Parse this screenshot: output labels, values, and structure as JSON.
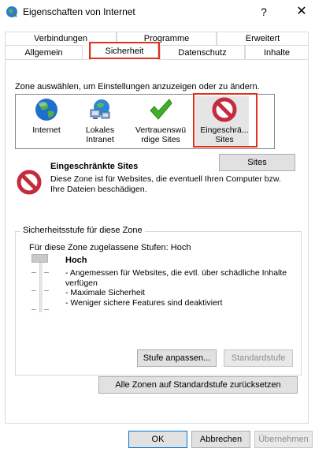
{
  "window": {
    "title": "Eigenschaften von Internet",
    "help_glyph": "?",
    "close_glyph": "✕"
  },
  "tabs": {
    "row1": [
      "Verbindungen",
      "Programme",
      "Erweitert"
    ],
    "row2": [
      "Allgemein",
      "Sicherheit",
      "Datenschutz",
      "Inhalte"
    ],
    "active": "Sicherheit"
  },
  "zones": {
    "instruction": "Zone auswählen, um Einstellungen anzuzeigen oder zu ändern.",
    "items": [
      {
        "line1": "Internet",
        "line2": "",
        "icon": "globe-icon"
      },
      {
        "line1": "Lokales",
        "line2": "Intranet",
        "icon": "intranet-icon"
      },
      {
        "line1": "Vertrauenswü",
        "line2": "rdige Sites",
        "icon": "checkmark-icon"
      },
      {
        "line1": "Eingeschrä...",
        "line2": "Sites",
        "icon": "restricted-icon"
      }
    ],
    "selected": "Eingeschrä... Sites"
  },
  "sites_button": "Sites",
  "description": {
    "title": "Eingeschränkte Sites",
    "line1": "Diese Zone ist für Websites, die eventuell Ihren Computer bzw.",
    "line2": "Ihre Dateien beschädigen."
  },
  "security": {
    "group_title": "Sicherheitsstufe für diese Zone",
    "allowed_levels": "Für diese Zone zugelassene Stufen: Hoch",
    "level_name": "Hoch",
    "bullets": [
      "- Angemessen für Websites, die evtl. über schädliche Inhalte",
      "verfügen",
      "- Maximale Sicherheit",
      "- Weniger sichere Features sind deaktiviert"
    ],
    "custom_level_button": "Stufe anpassen...",
    "default_level_button": "Standardstufe",
    "reset_all_button": "Alle Zonen auf Standardstufe zurücksetzen"
  },
  "footer": {
    "ok": "OK",
    "cancel": "Abbrechen",
    "apply": "Übernehmen"
  },
  "colors": {
    "highlight_red": "#e0301e",
    "restricted_red": "#c42b3c",
    "check_green": "#3fae29"
  }
}
